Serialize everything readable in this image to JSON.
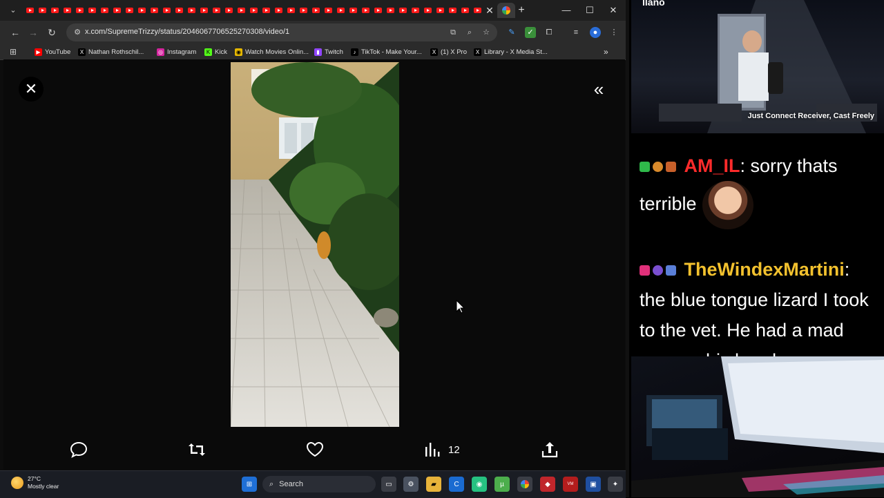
{
  "browser": {
    "tab_count_visible": 37,
    "tab_close": "✕",
    "new_tab": "+",
    "window": {
      "minimize": "—",
      "maximize": "☐",
      "close": "✕"
    },
    "url": "x.com/SupremeTrizzy/status/2046067706525270308/video/1",
    "bookmarks": [
      {
        "label": "YouTube",
        "icon": "youtube-icon",
        "color": "#ff0000"
      },
      {
        "label": "Nathan Rothschil...",
        "icon": "x-icon",
        "color": "#000000"
      },
      {
        "label": "Instagram",
        "icon": "instagram-icon",
        "color": "#d6249f"
      },
      {
        "label": "Kick",
        "icon": "kick-icon",
        "color": "#53fc18"
      },
      {
        "label": "Watch Movies Onlin...",
        "icon": "movies-icon",
        "color": "#e6b800"
      },
      {
        "label": "Twitch",
        "icon": "twitch-icon",
        "color": "#9146ff"
      },
      {
        "label": "TikTok - Make Your...",
        "icon": "tiktok-icon",
        "color": "#000000"
      },
      {
        "label": "(1) X Pro",
        "icon": "x-icon",
        "color": "#000000"
      },
      {
        "label": "Library - X Media St...",
        "icon": "x-icon",
        "color": "#000000"
      }
    ],
    "bookmarks_more": "»"
  },
  "viewer": {
    "close": "✕",
    "expand": "«",
    "views": "12"
  },
  "taskbar": {
    "temperature": "27°C",
    "condition": "Mostly clear",
    "search_label": "Search"
  },
  "overlay": {
    "logo": "llano",
    "cam_caption": "Just Connect Receiver, Cast Freely",
    "chat": [
      {
        "user": "AM_IL",
        "user_color": "#ff2b2b",
        "text": ": sorry thats terrible"
      },
      {
        "user": "TheWindexMartini",
        "user_color": "#f2c12e",
        "text": ": the blue tongue lizard I took to the vet. He had a mad scar on his head so"
      }
    ]
  },
  "colors": {
    "accent_red": "#ff1a1a",
    "viewer_bg": "#0a0a0a"
  }
}
